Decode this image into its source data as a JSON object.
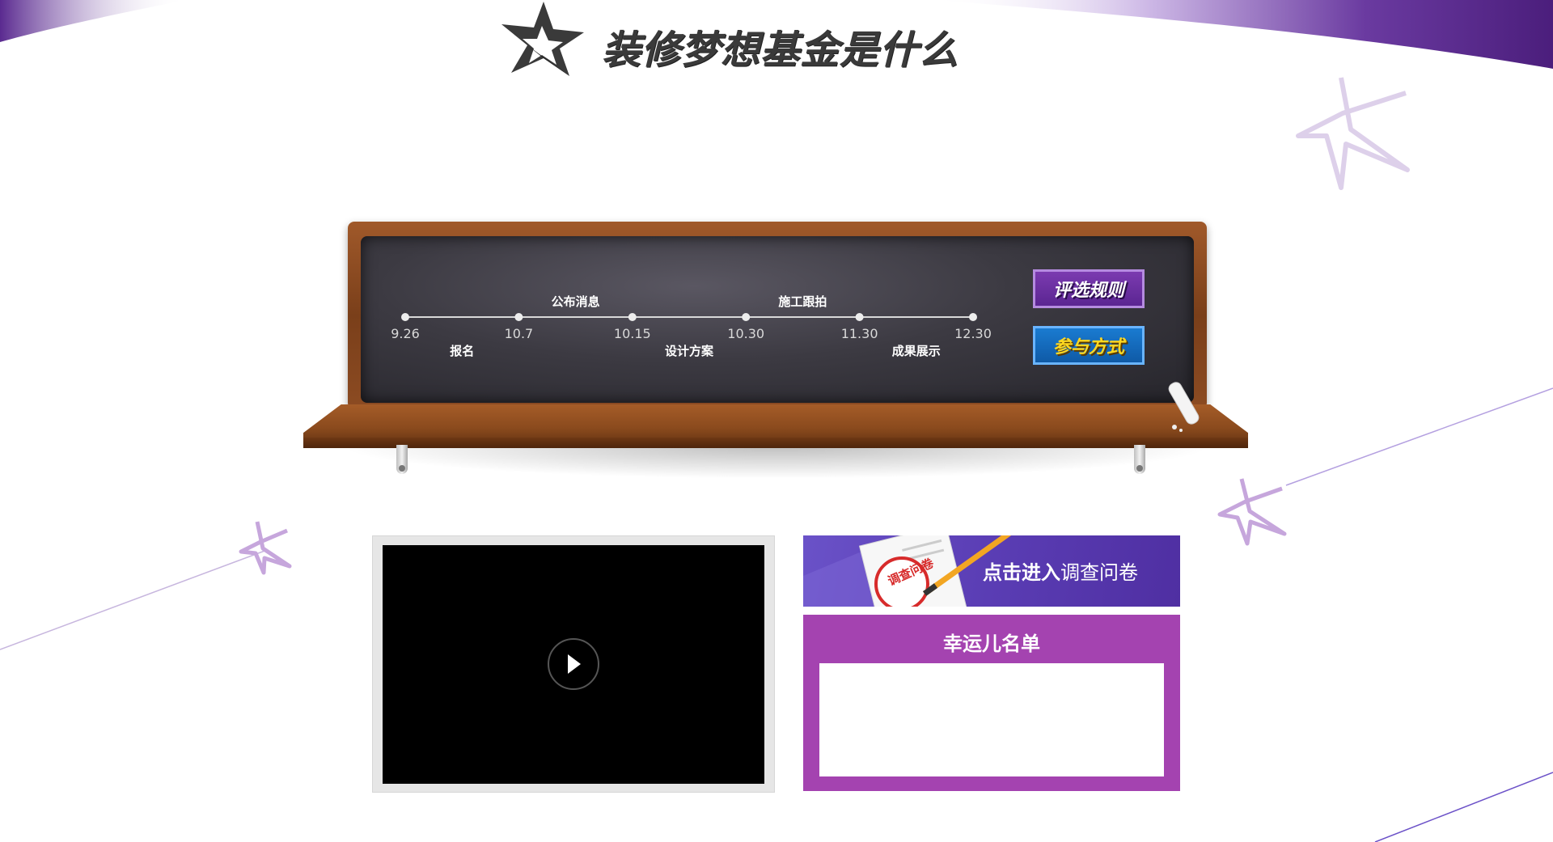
{
  "header": {
    "title": "装修梦想基金是什么",
    "logo_icon": "star-logo-icon"
  },
  "timeline": {
    "milestones": [
      {
        "date": "9.26"
      },
      {
        "date": "10.7"
      },
      {
        "date": "10.15"
      },
      {
        "date": "10.30"
      },
      {
        "date": "11.30"
      },
      {
        "date": "12.30"
      }
    ],
    "upper_labels": [
      "公布消息",
      "施工跟拍"
    ],
    "lower_labels": [
      "报名",
      "设计方案",
      "成果展示"
    ]
  },
  "buttons": {
    "rules_label": "评选规则",
    "join_label": "参与方式"
  },
  "video": {
    "play_icon": "play-icon"
  },
  "survey": {
    "strong_text": "点击进入",
    "rest_text": "调查问卷",
    "stamp_text": "调查问卷"
  },
  "lucky": {
    "title": "幸运儿名单"
  },
  "colors": {
    "purple_accent": "#5b2592",
    "blue_accent": "#0f5aa6",
    "lucky_bg": "#a443b0",
    "survey_bg": "#5a3db4"
  }
}
